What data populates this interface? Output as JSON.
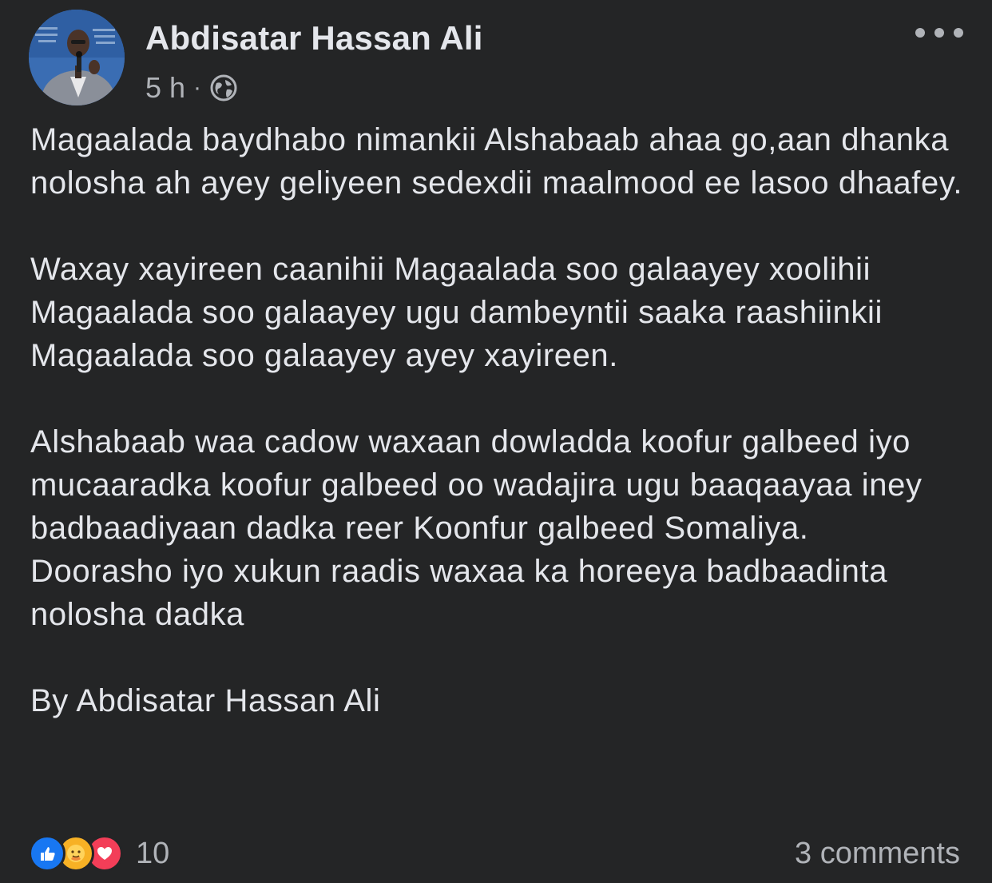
{
  "post": {
    "author": "Abdisatar Hassan Ali",
    "timestamp": "5 h",
    "separator": "·",
    "audience_icon": "globe-icon",
    "more_icon": "more-options-icon",
    "paragraphs": [
      "Magaalada baydhabo nimankii Alshabaab ahaa go,aan dhanka nolosha ah ayey geliyeen sedexdii maalmood ee lasoo dhaafey.",
      "Waxay xayireen caanihii Magaalada soo galaayey xoolihii Magaalada soo galaayey ugu dambeyntii saaka raashiinkii Magaalada soo galaayey ayey xayireen.",
      "Alshabaab waa cadow waxaan dowladda koofur galbeed iyo mucaaradka koofur galbeed oo wadajira ugu baaqaayaa iney badbaadiyaan dadka reer Koonfur galbeed Somaliya.",
      "Doorasho iyo xukun raadis waxaa ka horeeya badbaadinta nolosha dadka",
      "By Abdisatar Hassan Ali"
    ]
  },
  "footer": {
    "reactions": [
      "like-icon",
      "care-icon",
      "love-icon"
    ],
    "reaction_count": "10",
    "comments_label": "3 comments"
  },
  "colors": {
    "background": "#242526",
    "text_primary": "#e4e6eb",
    "text_secondary": "#b0b3b8",
    "like": "#1877f2",
    "care": "#f7b125",
    "love": "#f33e58"
  }
}
